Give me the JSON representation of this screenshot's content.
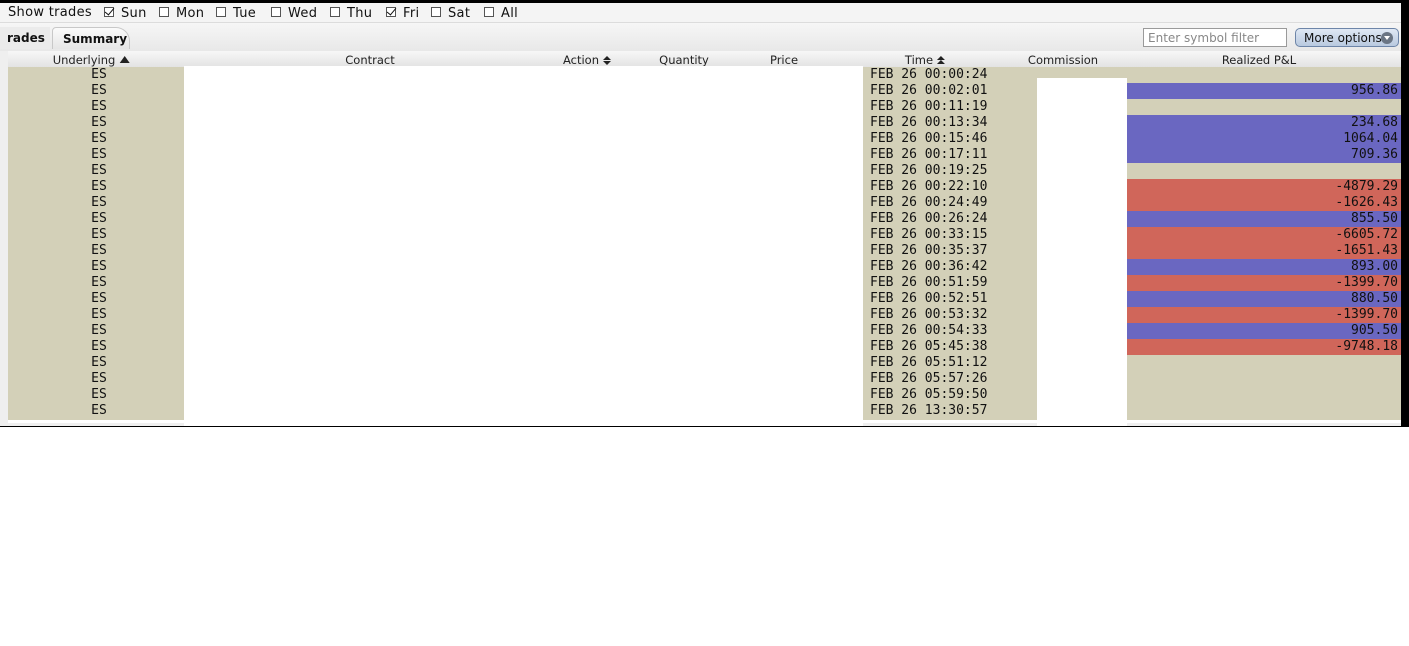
{
  "filter": {
    "show_label": "Show trades",
    "days": [
      {
        "label": "Sun",
        "checked": true
      },
      {
        "label": "Mon",
        "checked": false
      },
      {
        "label": "Tue",
        "checked": false
      },
      {
        "label": "Wed",
        "checked": false
      },
      {
        "label": "Thu",
        "checked": false
      },
      {
        "label": "Fri",
        "checked": true
      },
      {
        "label": "Sat",
        "checked": false
      },
      {
        "label": "All",
        "checked": false
      }
    ]
  },
  "tabs": {
    "trades": "rades",
    "summary": "Summary"
  },
  "toolbar": {
    "symbol_filter_placeholder": "Enter symbol filter",
    "more_options": "More options",
    "more_options_icon": "chevron-down-circle-icon"
  },
  "columns": {
    "underlying": "Underlying",
    "contract": "Contract",
    "action": "Action",
    "quantity": "Quantity",
    "price": "Price",
    "time": "Time",
    "commission": "Commission",
    "realized_pnl": "Realized P&L"
  },
  "colors": {
    "positive_pnl": "#6a67c1",
    "negative_pnl": "#d0665a",
    "row_background": "#d3d0b8"
  },
  "rows": [
    {
      "underlying": "ES",
      "time": "FEB 26 00:00:24",
      "pnl": ""
    },
    {
      "underlying": "ES",
      "time": "FEB 26 00:02:01",
      "pnl": "956.86"
    },
    {
      "underlying": "ES",
      "time": "FEB 26 00:11:19",
      "pnl": ""
    },
    {
      "underlying": "ES",
      "time": "FEB 26 00:13:34",
      "pnl": "234.68"
    },
    {
      "underlying": "ES",
      "time": "FEB 26 00:15:46",
      "pnl": "1064.04"
    },
    {
      "underlying": "ES",
      "time": "FEB 26 00:17:11",
      "pnl": "709.36"
    },
    {
      "underlying": "ES",
      "time": "FEB 26 00:19:25",
      "pnl": ""
    },
    {
      "underlying": "ES",
      "time": "FEB 26 00:22:10",
      "pnl": "-4879.29"
    },
    {
      "underlying": "ES",
      "time": "FEB 26 00:24:49",
      "pnl": "-1626.43"
    },
    {
      "underlying": "ES",
      "time": "FEB 26 00:26:24",
      "pnl": "855.50"
    },
    {
      "underlying": "ES",
      "time": "FEB 26 00:33:15",
      "pnl": "-6605.72"
    },
    {
      "underlying": "ES",
      "time": "FEB 26 00:35:37",
      "pnl": "-1651.43"
    },
    {
      "underlying": "ES",
      "time": "FEB 26 00:36:42",
      "pnl": "893.00"
    },
    {
      "underlying": "ES",
      "time": "FEB 26 00:51:59",
      "pnl": "-1399.70"
    },
    {
      "underlying": "ES",
      "time": "FEB 26 00:52:51",
      "pnl": "880.50"
    },
    {
      "underlying": "ES",
      "time": "FEB 26 00:53:32",
      "pnl": "-1399.70"
    },
    {
      "underlying": "ES",
      "time": "FEB 26 00:54:33",
      "pnl": "905.50"
    },
    {
      "underlying": "ES",
      "time": "FEB 26 05:45:38",
      "pnl": "-9748.18"
    },
    {
      "underlying": "ES",
      "time": "FEB 26 05:51:12",
      "pnl": ""
    },
    {
      "underlying": "ES",
      "time": "FEB 26 05:57:26",
      "pnl": ""
    },
    {
      "underlying": "ES",
      "time": "FEB 26 05:59:50",
      "pnl": ""
    },
    {
      "underlying": "ES",
      "time": "FEB 26 13:30:57",
      "pnl": ""
    }
  ]
}
